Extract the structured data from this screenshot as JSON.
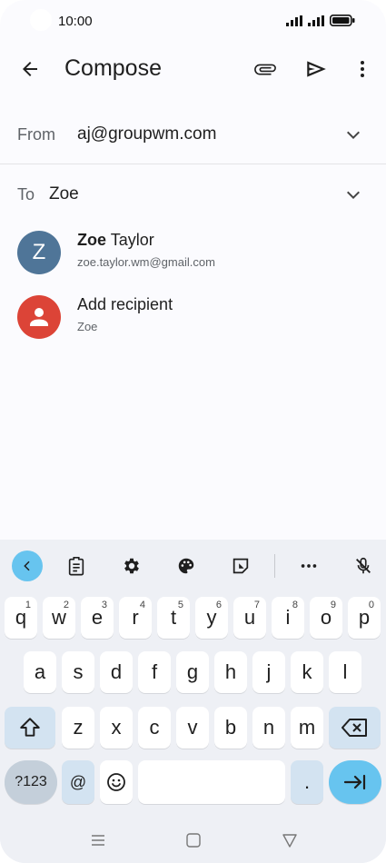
{
  "status_bar": {
    "time": "10:00"
  },
  "app_bar": {
    "title": "Compose"
  },
  "from": {
    "label": "From",
    "value": "aj@groupwm.com"
  },
  "to": {
    "label": "To",
    "value": "Zoe"
  },
  "suggestions": [
    {
      "initial": "Z",
      "name_bold": "Zoe",
      "name_rest": " Taylor",
      "subtitle": "zoe.taylor.wm@gmail.com",
      "avatar_color": "#4f7598"
    },
    {
      "name": "Add recipient",
      "subtitle": "Zoe",
      "avatar_color": "#dc4437"
    }
  ],
  "keyboard": {
    "row1": [
      {
        "key": "q",
        "hint": "1"
      },
      {
        "key": "w",
        "hint": "2"
      },
      {
        "key": "e",
        "hint": "3"
      },
      {
        "key": "r",
        "hint": "4"
      },
      {
        "key": "t",
        "hint": "5"
      },
      {
        "key": "y",
        "hint": "6"
      },
      {
        "key": "u",
        "hint": "7"
      },
      {
        "key": "i",
        "hint": "8"
      },
      {
        "key": "o",
        "hint": "9"
      },
      {
        "key": "p",
        "hint": "0"
      }
    ],
    "row2": [
      "a",
      "s",
      "d",
      "f",
      "g",
      "h",
      "j",
      "k",
      "l"
    ],
    "row3": [
      "z",
      "x",
      "c",
      "v",
      "b",
      "n",
      "m"
    ],
    "symbols_label": "?123",
    "at_label": "@",
    "period_label": "."
  },
  "colors": {
    "accent": "#67c4ef",
    "toolbar_back": "#67c4ef",
    "function_key": "#d3e3f1"
  }
}
